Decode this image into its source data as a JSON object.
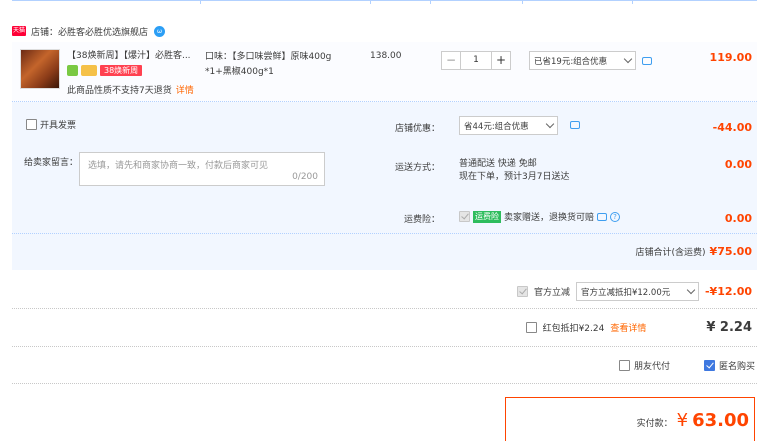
{
  "shop": {
    "badge": "天猫",
    "label": "店铺：",
    "name": "必胜客必胜优选旗舰店",
    "ww_icon": "chat-icon"
  },
  "item": {
    "title_line1": "【38焕新周】【爆汁】必胜客...",
    "promo_tag": "38焕新周",
    "no_return_text": "此商品性质不支持7天退货",
    "detail_link": "详情",
    "sku_line1": "口味：【多口味尝鲜】原味400g",
    "sku_line2": "*1+黑椒400g*1",
    "price": "138.00",
    "quantity": "1",
    "minus": "−",
    "plus": "+",
    "discount_select": "已省19元:组合优惠",
    "total": "119.00"
  },
  "order": {
    "invoice_label": "开具发票",
    "message_label": "给卖家留言：",
    "message_placeholder": "选填，请先和商家协商一致，付款后商家可见",
    "message_count": "0/200",
    "shop_discount_label": "店铺优惠：",
    "shop_discount_select": "省44元:组合优惠",
    "shop_discount_value": "-44.00",
    "shipping_label": "运送方式：",
    "shipping_line1": "普通配送 快递 免邮",
    "shipping_line2": "现在下单，预计3月7日送达",
    "shipping_value": "0.00",
    "insurance_label": "运费险：",
    "insurance_badge": "运费险",
    "insurance_text": "卖家赠送，退换货可赔",
    "insurance_value": "0.00",
    "shop_total_label": "店铺合计(含运费)",
    "shop_total_value": "¥75.00"
  },
  "summary": {
    "tmall_discount_label": "官方立减",
    "tmall_discount_select": "官方立减抵扣¥12.00元",
    "tmall_discount_value": "-¥12.00",
    "redpacket_label": "红包抵扣¥2.24",
    "redpacket_detail": "查看详情",
    "redpacket_value": "¥ 2.24",
    "friend_pay_label": "朋友代付",
    "anonymous_label": "匿名购买",
    "pay_label": "实付款：",
    "pay_currency": "¥",
    "pay_value": "63.00"
  },
  "colors": {
    "accent_red": "#ff4400",
    "line_blue": "#b2d1ff",
    "block_bg": "#f2f7ff"
  }
}
